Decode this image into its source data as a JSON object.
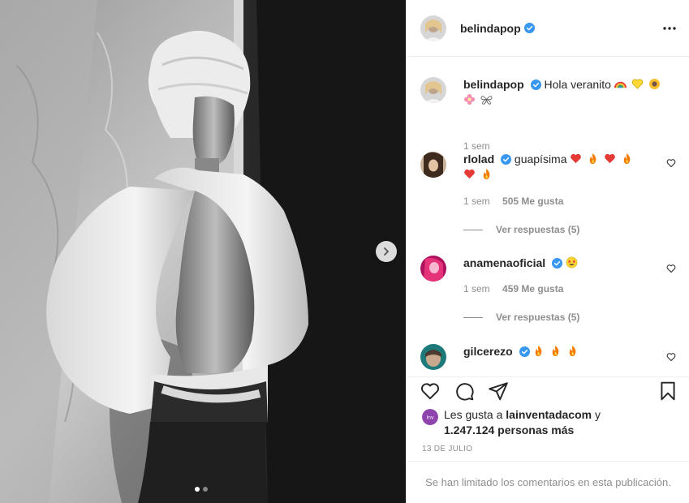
{
  "post": {
    "author": "belindapop",
    "caption_text": "Hola veranito",
    "caption_emojis": [
      "rainbow-emoji",
      "yellow-heart-emoji",
      "sunflower-emoji",
      "blossom-emoji",
      "butterfly-emoji"
    ],
    "caption_time": "1 sem",
    "date": "13 DE JULIO",
    "limited_comments_notice": "Se han limitado los comentarios en esta publicación."
  },
  "comments": [
    {
      "username": "rlolad",
      "text": "guapísima",
      "emojis": [
        "red-heart-emoji",
        "fire-emoji",
        "red-heart-emoji",
        "fire-emoji",
        "red-heart-emoji",
        "fire-emoji"
      ],
      "time": "1 sem",
      "likes": "505 Me gusta",
      "replies": "Ver respuestas (5)"
    },
    {
      "username": "anamenaoficial",
      "text": "",
      "emojis": [
        "star-struck-emoji"
      ],
      "time": "1 sem",
      "likes": "459 Me gusta",
      "replies": "Ver respuestas (5)"
    },
    {
      "username": "gilcerezo",
      "text": "",
      "emojis": [
        "fire-emoji",
        "fire-emoji",
        "fire-emoji"
      ]
    }
  ],
  "likes_summary": {
    "prefix": "Les gusta a",
    "user": "lainventadacom",
    "connector": "y",
    "others": "1.247.124 personas más"
  },
  "icons": {
    "verified_color": "#3897f0",
    "heart": "heart-outline-icon",
    "comment": "comment-icon",
    "share": "paper-plane-icon",
    "save": "bookmark-icon",
    "more": "ellipsis-icon",
    "next": "chevron-right-icon"
  }
}
